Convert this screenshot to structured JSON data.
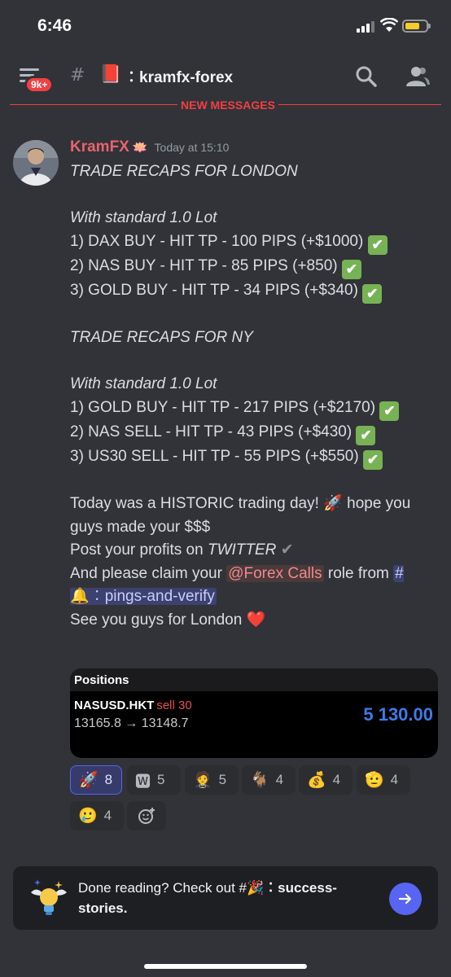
{
  "status_bar": {
    "time": "6:46"
  },
  "header": {
    "notification_badge": "9k+",
    "channel_emoji": "📕",
    "channel_name": "kramfx-forex"
  },
  "divider": {
    "label": "NEW MESSAGES"
  },
  "message": {
    "author": "KramFX",
    "author_decoration": "🪷",
    "timestamp": "Today at 15:10",
    "lines": {
      "l1": "TRADE RECAPS FOR LONDON",
      "l2": "With standard 1.0 Lot",
      "l3": "1) DAX BUY - HIT TP - 100 PIPS (+$1000)",
      "l4": "2) NAS BUY - HIT TP - 85 PIPS (+850)",
      "l5": "3) GOLD BUY - HIT TP - 34 PIPS (+$340)",
      "l6": "TRADE RECAPS FOR NY",
      "l7": "With standard 1.0 Lot",
      "l8": "1) GOLD BUY - HIT TP - 217 PIPS (+$2170)",
      "l9": "2) NAS SELL - HIT TP - 43 PIPS (+$430)",
      "l10": "3) US30 SELL - HIT TP - 55 PIPS (+$550)",
      "l11a": "Today was a HISTORIC trading day!",
      "l11b": "hope you guys made your $$$",
      "l12a": "Post your profits on",
      "l12b": "TWITTER",
      "l13a": "And please claim your",
      "l13_role": "@Forex Calls",
      "l13b": "role from",
      "channel_mention": "pings-and-verify",
      "l14": "See you guys for London"
    },
    "check_glyph": "✔",
    "rocket": "🚀",
    "bell": "🔔",
    "heart": "❤️"
  },
  "positions": {
    "title": "Positions",
    "symbol": "NASUSD.HKT",
    "side": "sell 30",
    "prices": "13165.8 → 13148.7",
    "profit": "5 130.00"
  },
  "reactions": [
    {
      "emoji": "🚀",
      "count": "8"
    },
    {
      "emoji": "🆆",
      "count": "5"
    },
    {
      "emoji": "🤵",
      "count": "5"
    },
    {
      "emoji": "🐐",
      "count": "4"
    },
    {
      "emoji": "💰",
      "count": "4"
    },
    {
      "emoji": "🫡",
      "count": "4"
    },
    {
      "emoji": "🥲",
      "count": "4"
    }
  ],
  "banner": {
    "text_a": "Done reading? Check out #",
    "emoji": "🎉",
    "channel": "success-stories."
  },
  "colors": {
    "accent": "#5865f2",
    "author": "#e8636f",
    "new_messages": "#f23f43"
  }
}
